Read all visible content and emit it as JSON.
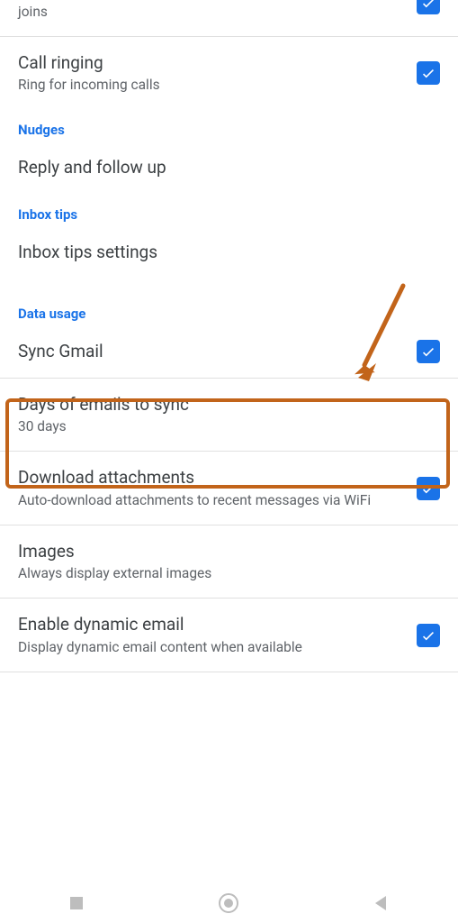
{
  "rows": {
    "leave_call": {
      "desc": "Removes you from a call after a few minutes if no one else joins",
      "checked": true
    },
    "call_ringing": {
      "title": "Call ringing",
      "desc": "Ring for incoming calls",
      "checked": true
    },
    "reply_follow_up": {
      "title": "Reply and follow up"
    },
    "inbox_tips_settings": {
      "title": "Inbox tips settings"
    },
    "sync_gmail": {
      "title": "Sync Gmail",
      "checked": true
    },
    "days_sync": {
      "title": "Days of emails to sync",
      "desc": "30 days"
    },
    "download_attachments": {
      "title": "Download attachments",
      "desc": "Auto-download attachments to recent messages via WiFi",
      "checked": true
    },
    "images": {
      "title": "Images",
      "desc": "Always display external images"
    },
    "dynamic_email": {
      "title": "Enable dynamic email",
      "desc": "Display dynamic email content when available",
      "checked": true
    }
  },
  "sections": {
    "nudges": "Nudges",
    "inbox_tips": "Inbox tips",
    "data_usage": "Data usage"
  },
  "annotation": {
    "highlight_target": "data-usage-section",
    "arrow_color": "#c2641a"
  }
}
